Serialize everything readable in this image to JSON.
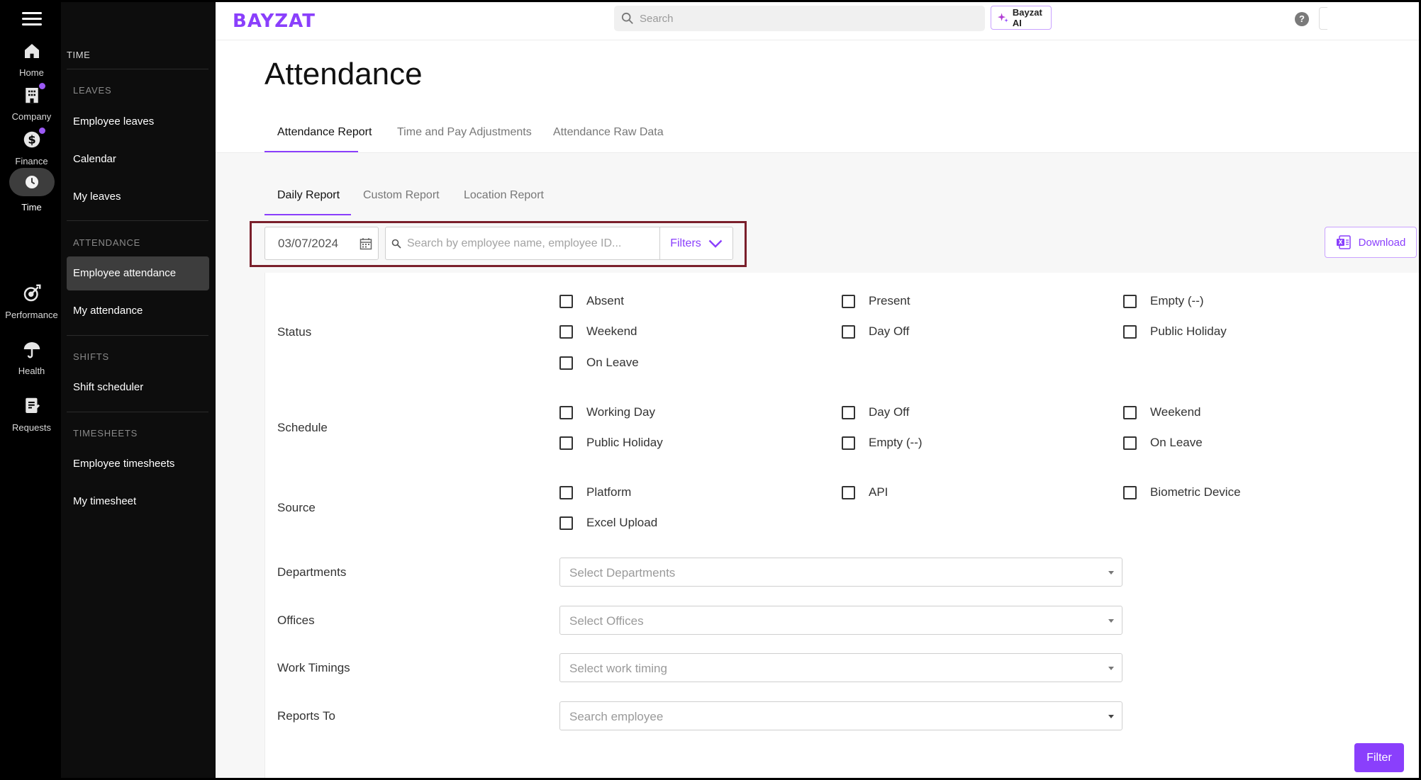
{
  "app": {
    "logo": "BAYZAT"
  },
  "rail": {
    "items": [
      {
        "label": "Home",
        "icon": "home-icon"
      },
      {
        "label": "Company",
        "icon": "building-icon",
        "badge": true
      },
      {
        "label": "Finance",
        "icon": "dollar-icon",
        "badge": true
      },
      {
        "label": "Time",
        "icon": "clock-icon",
        "active": true
      },
      {
        "label": "Performance",
        "icon": "target-icon"
      },
      {
        "label": "Health",
        "icon": "umbrella-icon"
      },
      {
        "label": "Requests",
        "icon": "requests-icon"
      }
    ]
  },
  "sidebar": {
    "title": "TIME",
    "groups": [
      {
        "label": "LEAVES",
        "items": [
          "Employee leaves",
          "Calendar",
          "My leaves"
        ]
      },
      {
        "label": "ATTENDANCE",
        "items": [
          "Employee attendance",
          "My attendance"
        ]
      },
      {
        "label": "SHIFTS",
        "items": [
          "Shift scheduler"
        ]
      },
      {
        "label": "TIMESHEETS",
        "items": [
          "Employee timesheets",
          "My timesheet"
        ]
      }
    ],
    "active_item": "Employee attendance"
  },
  "topbar": {
    "search_placeholder": "Search",
    "ai_label": "Bayzat AI",
    "help": "?"
  },
  "page": {
    "title": "Attendance",
    "tabs": [
      "Attendance Report",
      "Time and Pay Adjustments",
      "Attendance Raw Data"
    ],
    "active_tab": "Attendance Report",
    "subtabs": [
      "Daily Report",
      "Custom Report",
      "Location Report"
    ],
    "active_subtab": "Daily Report"
  },
  "toolbar": {
    "date": "03/07/2024",
    "search_placeholder": "Search by employee name, employee ID...",
    "filters_label": "Filters",
    "download_label": "Download"
  },
  "filters": {
    "status": {
      "label": "Status",
      "options": [
        "Absent",
        "Present",
        "Empty (--)",
        "Weekend",
        "Day Off",
        "Public Holiday",
        "On Leave"
      ]
    },
    "schedule": {
      "label": "Schedule",
      "options": [
        "Working Day",
        "Day Off",
        "Weekend",
        "Public Holiday",
        "Empty (--)",
        "On Leave"
      ]
    },
    "source": {
      "label": "Source",
      "options": [
        "Platform",
        "API",
        "Biometric Device",
        "Excel Upload"
      ]
    },
    "departments": {
      "label": "Departments",
      "placeholder": "Select Departments"
    },
    "offices": {
      "label": "Offices",
      "placeholder": "Select Offices"
    },
    "work_timings": {
      "label": "Work Timings",
      "placeholder": "Select work timing"
    },
    "reports_to": {
      "label": "Reports To",
      "placeholder": "Search employee"
    },
    "submit_label": "Filter"
  },
  "colors": {
    "brand": "#8a3ffc",
    "rail_bg": "#000000",
    "sidebar_bg": "#0d0d0d",
    "highlight": "#7a1f2b"
  }
}
